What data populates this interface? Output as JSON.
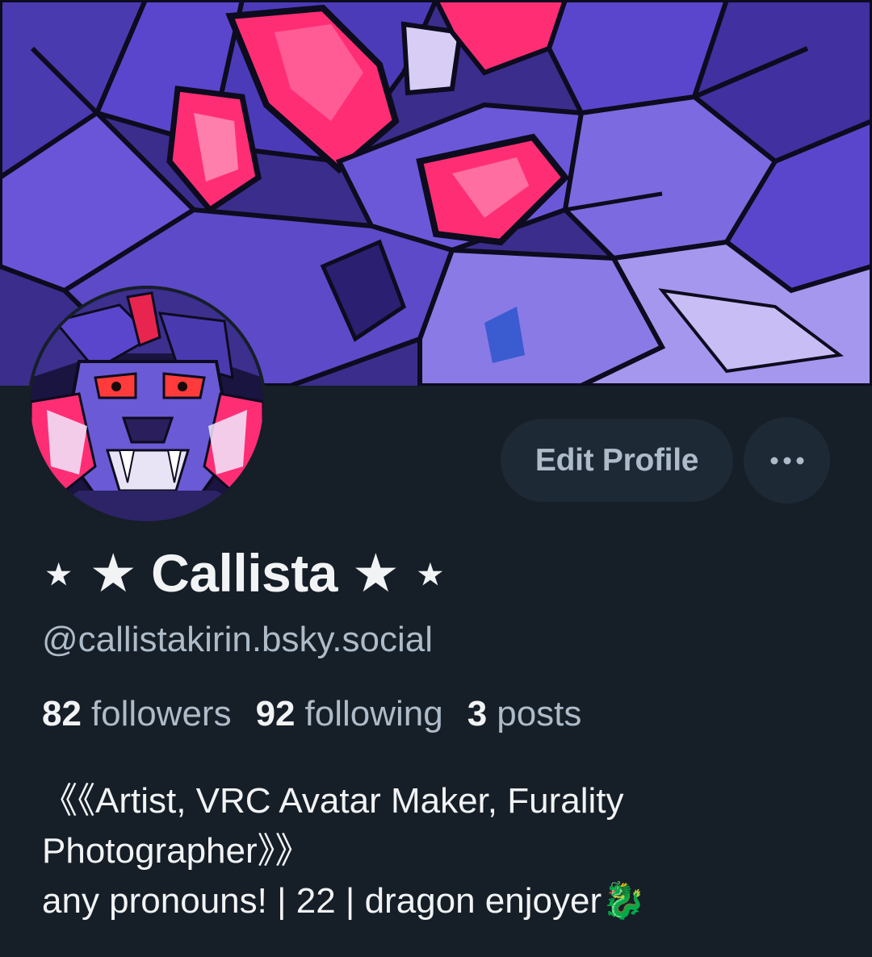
{
  "profile": {
    "display_name": "⋆ ★ Callista ★ ⋆",
    "handle": "@callistakirin.bsky.social",
    "banner_image": "purple-dragon-banner-art",
    "avatar_image": "purple-dragon-avatar-art"
  },
  "actions": {
    "edit_profile_label": "Edit Profile",
    "more_icon": "ellipsis-icon"
  },
  "stats": {
    "followers_count": "82",
    "followers_label": "followers",
    "following_count": "92",
    "following_label": "following",
    "posts_count": "3",
    "posts_label": "posts"
  },
  "bio": {
    "line1": "《《Artist, VRC Avatar Maker, Furality",
    "line2": "Photographer》》",
    "line3": "any pronouns! | 22 | dragon enjoyer🐉"
  },
  "colors": {
    "background": "#161e27",
    "button_bg": "#1e2936",
    "muted_text": "#aebbc9",
    "primary_text": "#f1f3f5",
    "banner_purple": "#5b3fd0",
    "accent_red": "#ff2e74"
  }
}
